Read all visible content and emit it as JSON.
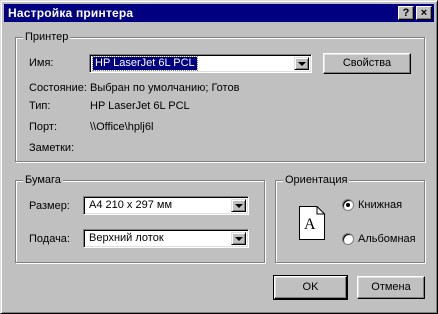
{
  "window": {
    "title": "Настройка принтера"
  },
  "titlebar_buttons": {
    "help": "?",
    "close": "×"
  },
  "printer_group": {
    "legend": "Принтер",
    "name_label": "Имя:",
    "name_value": "HP LaserJet 6L PCL",
    "properties_button": "Свойства",
    "status_label": "Состояние:",
    "status_value": "Выбран по умолчанию; Готов",
    "type_label": "Тип:",
    "type_value": "HP LaserJet 6L PCL",
    "port_label": "Порт:",
    "port_value": "\\\\Office\\hplj6l",
    "notes_label": "Заметки:"
  },
  "paper_group": {
    "legend": "Бумага",
    "size_label": "Размер:",
    "size_value": "A4 210 x 297 мм",
    "source_label": "Подача:",
    "source_value": "Верхний лоток"
  },
  "orientation_group": {
    "legend": "Ориентация",
    "portrait_label": "Книжная",
    "landscape_label": "Альбомная",
    "selected": "portrait",
    "page_letter": "A"
  },
  "buttons": {
    "ok": "OK",
    "cancel": "Отмена"
  }
}
